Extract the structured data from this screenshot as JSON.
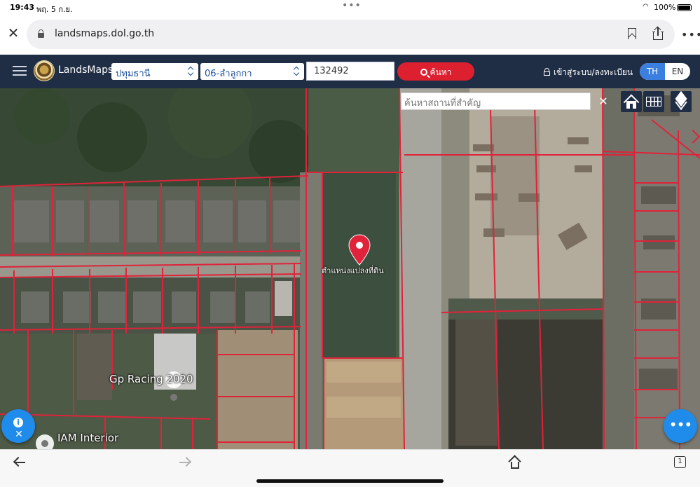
{
  "status_bar": {
    "time": "19:43",
    "date": "พฤ. 5 ก.ย.",
    "battery": "100%"
  },
  "browser": {
    "url": "landsmaps.dol.go.th"
  },
  "app": {
    "brand": "LandsMaps",
    "province": "ปทุมธานี",
    "district": "06-ลำลูกกา",
    "parcel_number": "132492",
    "search_label": "ค้นหา",
    "login_label": "เข้าสู่ระบบ/ลงทะเบียน",
    "lang_th": "TH",
    "lang_en": "EN"
  },
  "map": {
    "place_search_placeholder": "ค้นหาสถานที่สำคัญ",
    "clear_label": "✕",
    "pin_label": "ตำแหน่งแปลงที่ดิน",
    "poi_labels": [
      "Gp Racing 2020",
      "IAM Interior"
    ],
    "boundary_color": "#e0223a",
    "pin_color": "#e0223a",
    "fab_color": "#1f8bea"
  },
  "toolbar": {
    "tab_count": "1"
  }
}
